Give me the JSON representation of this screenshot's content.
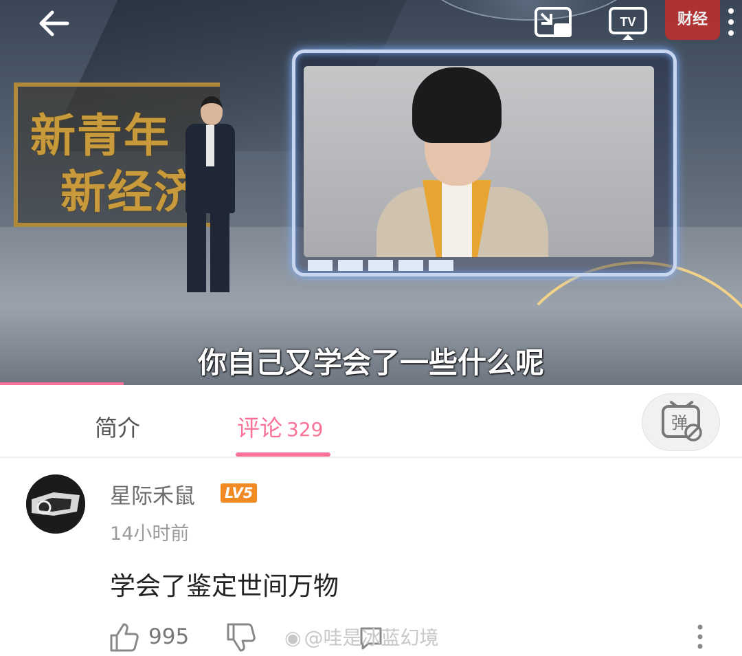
{
  "video": {
    "backdrop_sign_line1": "新青年",
    "backdrop_sign_line2": "新经济",
    "subtitle": "你自己又学会了一些什么呢",
    "channel_badge": "财经",
    "progress_fraction": 0.167
  },
  "tabs": {
    "intro_label": "简介",
    "comments_label": "评论",
    "comments_count": "329"
  },
  "danmaku": {
    "label": "弹"
  },
  "comment": {
    "username": "星际禾鼠",
    "level": "LV5",
    "time": "14小时前",
    "text": "学会了鉴定世间万物",
    "like_count": "995"
  },
  "watermark": {
    "text": "@哇是冰蓝幻境"
  },
  "colors": {
    "accent": "#fb7299",
    "level_badge": "#f08a24"
  },
  "icons": [
    "back-arrow-icon",
    "pip-icon",
    "cast-tv-icon",
    "more-vertical-icon",
    "danmaku-toggle-icon",
    "thumb-up-icon",
    "thumb-down-icon",
    "reply-icon"
  ]
}
